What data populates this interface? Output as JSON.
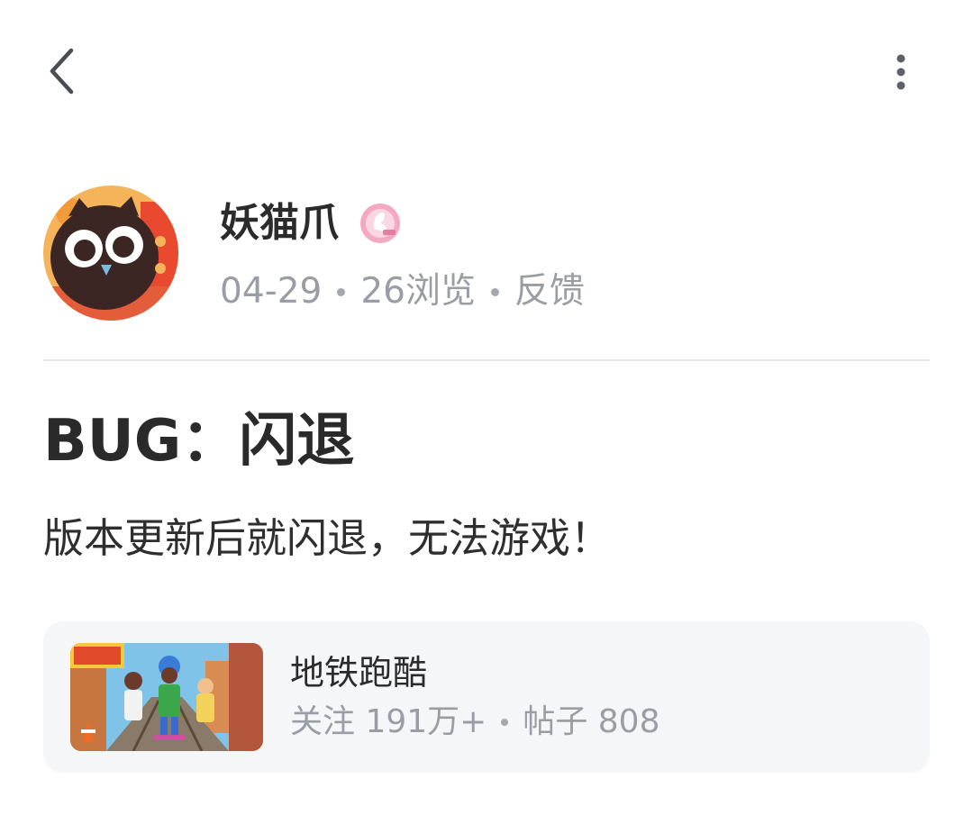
{
  "header": {
    "back_icon": "chevron-left-icon",
    "more_icon": "more-vertical-icon"
  },
  "author": {
    "name": "妖猫爪",
    "badge_icon": "anniversary-badge-icon",
    "avatar": "cartoon-cat-avatar",
    "date": "04-29",
    "views": "26浏览",
    "feedback_label": "反馈"
  },
  "post": {
    "title": "BUG：闪退",
    "body": "版本更新后就闪退，无法游戏！"
  },
  "game": {
    "name": "地铁跑酷",
    "followers": "关注 191万+",
    "posts": "帖子 808",
    "thumbnail": "subway-surfers-thumbnail"
  },
  "colors": {
    "text_primary": "#2b2b2b",
    "text_secondary": "#9a9ea4",
    "divider": "#e9eaec",
    "card_bg": "#f5f6f8",
    "badge_pink": "#f4a9c3"
  }
}
